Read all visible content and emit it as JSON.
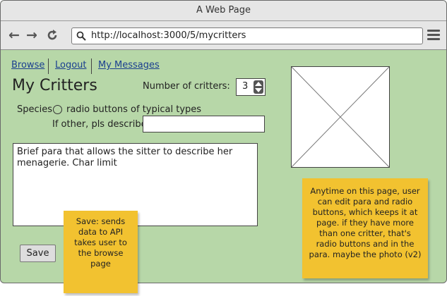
{
  "window": {
    "title": "A Web Page"
  },
  "browser": {
    "url": "http://localhost:3000/5/mycritters",
    "back_icon": "arrow-left-icon",
    "forward_icon": "arrow-right-icon",
    "reload_icon": "reload-icon",
    "menu_icon": "hamburger-menu-icon"
  },
  "nav": {
    "items": [
      {
        "label": "Browse"
      },
      {
        "label": "Logout"
      },
      {
        "label": "My Messages"
      }
    ]
  },
  "page": {
    "title": "My Critters",
    "critter_count_label": "Number of critters:",
    "critter_count_value": "3",
    "species_label": "Species",
    "species_radio_label": "radio buttons of typical types",
    "other_label": "If other, pls describe:",
    "other_value": "",
    "para_text": "Brief para that allows the sitter to describe her menagerie. Char limit",
    "save_label": "Save"
  },
  "notes": [
    {
      "text": "Anytime on this page, user can edit para and radio buttons, which keeps it at page. if they  have more than one critter, that's radio buttons and in the para. maybe the photo (v2)"
    },
    {
      "text": "Save: sends data to API takes user to the browse page"
    }
  ],
  "colors": {
    "page_background": "#b7d7a8",
    "sticky_note": "#f2c230",
    "link": "#1a3f8f"
  }
}
